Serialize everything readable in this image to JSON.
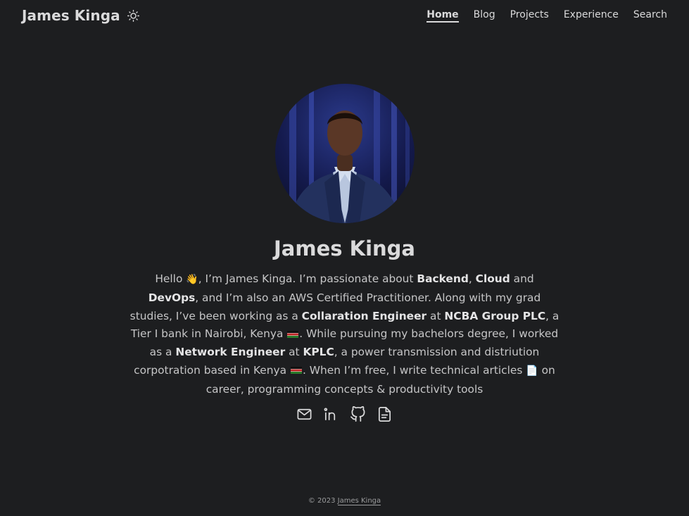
{
  "header": {
    "logo": "James Kinga",
    "theme_toggle_icon": "sun-icon",
    "nav": [
      {
        "label": "Home",
        "active": true
      },
      {
        "label": "Blog",
        "active": false
      },
      {
        "label": "Projects",
        "active": false
      },
      {
        "label": "Experience",
        "active": false
      },
      {
        "label": "Search",
        "active": false
      }
    ]
  },
  "profile": {
    "name": "James Kinga",
    "bio": {
      "p1": "Hello ",
      "p2": ", I’m James Kinga. I’m passionate about ",
      "b1": "Backend",
      "p3": ", ",
      "b2": "Cloud",
      "p4": " and ",
      "b3": "DevOps",
      "p5": ", and I’m also an AWS Certified Practitioner. Along with my grad studies, I’ve been working as a ",
      "b4": "Collaration Engineer",
      "p6": " at ",
      "b5": "NCBA Group PLC",
      "p7": ", a Tier I bank in Nairobi, Kenya ",
      "p8": ". While pursuing my bachelors degree, I worked as a ",
      "b6": "Network Engineer",
      "p9": " at ",
      "b7": "KPLC",
      "p10": ", a power transmission and distriution corpotration based in Kenya ",
      "p11": ". When I’m free, I write technical articles ",
      "p12": " on career, programming concepts & productivity tools",
      "wave_emoji": "👋",
      "doc_emoji": "📄"
    },
    "socials": [
      {
        "name": "email-icon"
      },
      {
        "name": "linkedin-icon"
      },
      {
        "name": "github-icon"
      },
      {
        "name": "resume-icon"
      }
    ]
  },
  "footer": {
    "copyright": "© 2023 ",
    "link": "James Kinga"
  }
}
